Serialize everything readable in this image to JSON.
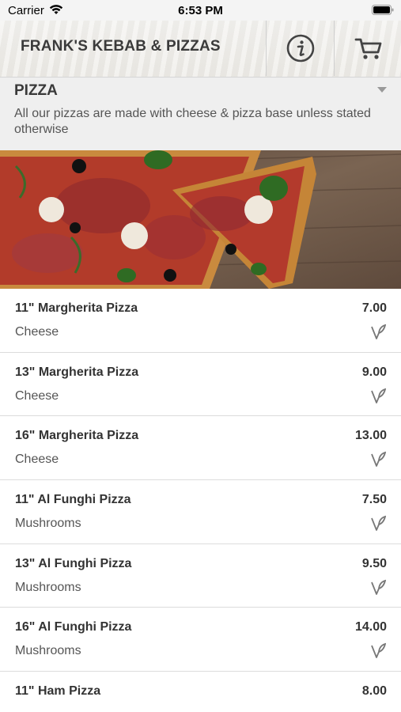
{
  "status_bar": {
    "carrier": "Carrier",
    "time": "6:53 PM"
  },
  "header": {
    "title": "FRANK'S KEBAB & PIZZAS",
    "icons": [
      "info-icon",
      "cart-icon"
    ]
  },
  "category": {
    "title": "PIZZA",
    "description": "All our pizzas are made with cheese & pizza base unless stated otherwise"
  },
  "menu_items": [
    {
      "name": "11\" Margherita Pizza",
      "price": "7.00",
      "description": "Cheese",
      "vegetarian": true
    },
    {
      "name": "13\" Margherita Pizza",
      "price": "9.00",
      "description": "Cheese",
      "vegetarian": true
    },
    {
      "name": "16\" Margherita Pizza",
      "price": "13.00",
      "description": "Cheese",
      "vegetarian": true
    },
    {
      "name": "11\" Al Funghi Pizza",
      "price": "7.50",
      "description": "Mushrooms",
      "vegetarian": true
    },
    {
      "name": "13\" Al Funghi Pizza",
      "price": "9.50",
      "description": "Mushrooms",
      "vegetarian": true
    },
    {
      "name": "16\" Al Funghi Pizza",
      "price": "14.00",
      "description": "Mushrooms",
      "vegetarian": true
    },
    {
      "name": "11\" Ham Pizza",
      "price": "8.00",
      "description": "",
      "vegetarian": false
    }
  ]
}
